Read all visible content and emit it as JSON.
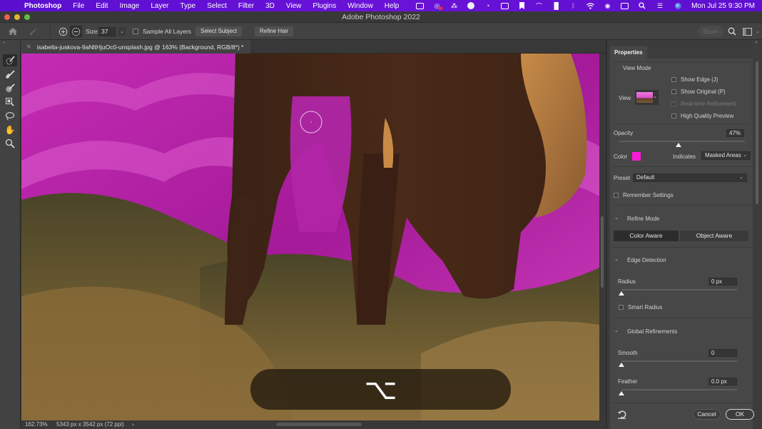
{
  "menubar": {
    "app": "Photoshop",
    "items": [
      "File",
      "Edit",
      "Image",
      "Layer",
      "Type",
      "Select",
      "Filter",
      "3D",
      "View",
      "Plugins",
      "Window",
      "Help"
    ],
    "status_icons": [
      "screen-record-icon",
      "creative-cloud-icon",
      "dropbox-icon",
      "scroll-icon",
      "sync-icon",
      "screen-share-icon",
      "bookmark-icon",
      "gauge-icon",
      "grid-icon",
      "bluetooth-icon",
      "wifi-icon",
      "user-icon",
      "battery-icon",
      "search-icon",
      "control-center-icon",
      "siri-icon"
    ],
    "clock": "Mon Jul 25  9:30 PM"
  },
  "window": {
    "title": "Adobe Photoshop 2022"
  },
  "options_bar": {
    "size_label": "Size:",
    "size_value": "37",
    "sample_all_layers": "Sample All Layers",
    "select_subject": "Select Subject",
    "refine_hair": "Refine Hair",
    "share": "Share"
  },
  "tools": [
    "refine-edge-brush",
    "brush",
    "object-selection-brush",
    "quick-selection",
    "lasso",
    "hand",
    "zoom"
  ],
  "document": {
    "tab_title": "isabella-juskova-9aNltHjuOc0-unsplash.jpg @ 163% (Background, RGB/8*) *"
  },
  "status": {
    "zoom": "162.73%",
    "dimensions": "5343 px x 3542 px (72 ppi)",
    "arrow": "›"
  },
  "key_hint": {
    "symbol": "⌥"
  },
  "properties": {
    "tab": "Properties",
    "view_mode": {
      "heading": "View Mode",
      "view_label": "View",
      "show_edge": "Show Edge (J)",
      "show_original": "Show Original (P)",
      "realtime_refinement": "Real-time Refinement",
      "high_quality_preview": "High Quality Preview"
    },
    "opacity": {
      "label": "Opacity",
      "value": "47%",
      "fraction": 0.47
    },
    "color": {
      "label": "Color",
      "swatch": "#ff1ad9",
      "indicates_label": "Indicates",
      "indicates_value": "Masked Areas"
    },
    "preset": {
      "label": "Preset",
      "value": "Default"
    },
    "remember_settings": "Remember Settings",
    "refine_mode": {
      "heading": "Refine Mode",
      "color_aware": "Color Aware",
      "object_aware": "Object Aware"
    },
    "edge_detection": {
      "heading": "Edge Detection",
      "radius_label": "Radius",
      "radius_value": "0 px",
      "radius_fraction": 0,
      "smart_radius": "Smart Radius"
    },
    "global_refinements": {
      "heading": "Global Refinements",
      "smooth_label": "Smooth",
      "smooth_value": "0",
      "smooth_fraction": 0,
      "feather_label": "Feather",
      "feather_value": "0.0 px",
      "feather_fraction": 0
    },
    "cancel": "Cancel",
    "ok": "OK"
  }
}
